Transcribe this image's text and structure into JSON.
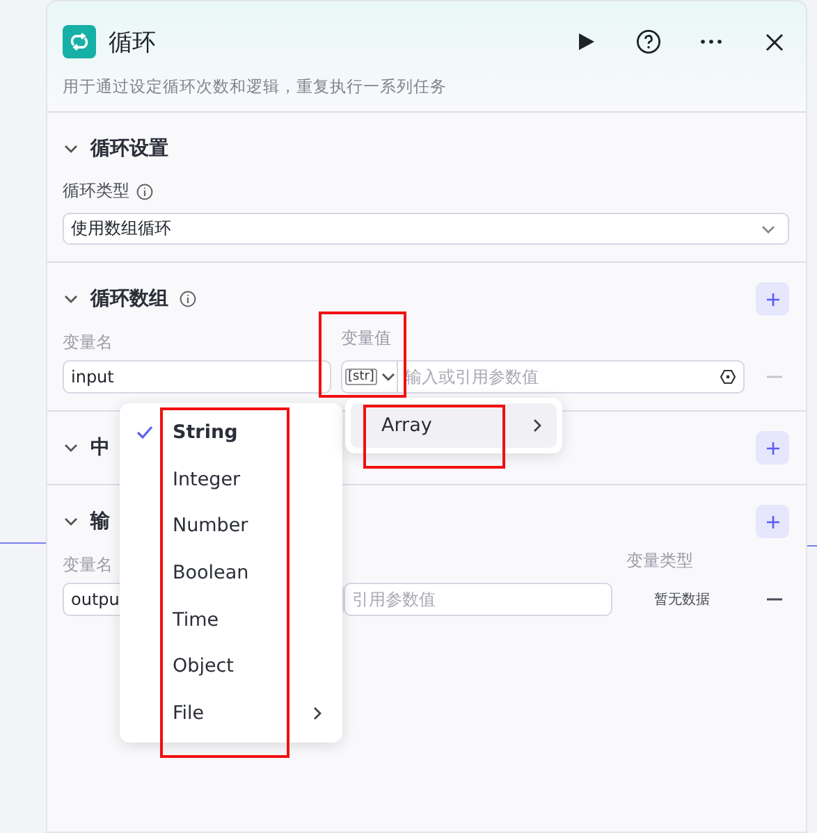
{
  "header": {
    "title": "循环",
    "description": "用于通过设定循环次数和逻辑，重复执行一系列任务"
  },
  "sections": [
    {
      "kind": "settings",
      "title": "循环设置",
      "expanded": true,
      "info": false,
      "addable": false,
      "field_label": "循环类型",
      "field_info": true,
      "select_value": "使用数组循环"
    },
    {
      "kind": "inputs",
      "title": "循环数组",
      "expanded": true,
      "info": true,
      "addable": true,
      "columns": [
        "变量名",
        "变量值"
      ],
      "row": {
        "name": "input",
        "type_tag": "[str]",
        "value_placeholder": "输入或引用参数值"
      }
    },
    {
      "kind": "empty",
      "title": "中",
      "expanded": true,
      "info": false,
      "addable": true
    },
    {
      "kind": "outputs",
      "title": "输",
      "expanded": true,
      "info": false,
      "addable": true,
      "columns": [
        "变量名",
        "变量类型"
      ],
      "row": {
        "name": "outpu",
        "value_placeholder": "引用参数值",
        "type": "暂无数据"
      }
    }
  ],
  "type_menu": {
    "items": [
      {
        "label": "String",
        "selected": true,
        "submenu": false
      },
      {
        "label": "Integer",
        "selected": false,
        "submenu": false
      },
      {
        "label": "Number",
        "selected": false,
        "submenu": false
      },
      {
        "label": "Boolean",
        "selected": false,
        "submenu": false
      },
      {
        "label": "Time",
        "selected": false,
        "submenu": false
      },
      {
        "label": "Object",
        "selected": false,
        "submenu": false
      },
      {
        "label": "File",
        "selected": false,
        "submenu": true
      }
    ]
  },
  "sub_menu": {
    "items": [
      {
        "label": "Array",
        "highlighted": true,
        "submenu": true
      }
    ]
  },
  "annotations": [
    {
      "kind": "box"
    },
    {
      "kind": "box"
    },
    {
      "kind": "box"
    }
  ]
}
